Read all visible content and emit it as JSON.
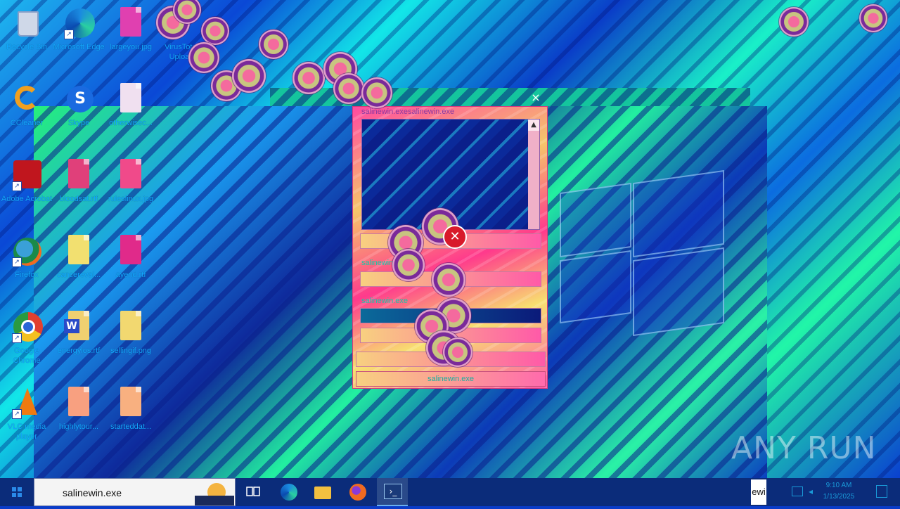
{
  "desktop": {
    "icons": [
      {
        "label": "Recycle Bin",
        "icon": "recycle-bin-icon"
      },
      {
        "label": "Microsoft Edge",
        "icon": "edge-icon"
      },
      {
        "label": "largeyou.jpg",
        "icon": "image-file-icon"
      },
      {
        "label": "VirusTotal Upload",
        "icon": "virustotal-icon"
      },
      {
        "label": "CCleaner",
        "icon": "ccleaner-icon"
      },
      {
        "label": "Skype",
        "icon": "skype-icon"
      },
      {
        "label": "otherwisec...",
        "icon": "image-file-icon"
      },
      {
        "label": "Adobe Acrobat",
        "icon": "acrobat-icon"
      },
      {
        "label": "bloodsat.rtf",
        "icon": "word-doc-icon"
      },
      {
        "label": "ruleslinux.jpg",
        "icon": "image-file-icon"
      },
      {
        "label": "Firefox",
        "icon": "firefox-icon"
      },
      {
        "label": "cancereval...",
        "icon": "image-file-icon"
      },
      {
        "label": "ayend.rtf",
        "icon": "word-doc-icon"
      },
      {
        "label": "Google Chrome",
        "icon": "chrome-icon"
      },
      {
        "label": "energylos.rtf",
        "icon": "word-doc-icon"
      },
      {
        "label": "sellingif.png",
        "icon": "image-file-icon"
      },
      {
        "label": "VLC media player",
        "icon": "vlc-icon"
      },
      {
        "label": "highlytour...",
        "icon": "image-file-icon"
      },
      {
        "label": "starteddat...",
        "icon": "image-file-icon"
      }
    ]
  },
  "app_window": {
    "title": "salinewin.exesalinewin.exe",
    "field_label_1": "salinewin",
    "field_label_2": "salinewin.exe",
    "footer": "salinewin.exe",
    "close_glyph": "×",
    "scroll_up_glyph": "▲",
    "error_glyph": "✕"
  },
  "watermark": "ANY RUN",
  "taskbar": {
    "search_value": "salinewin.exe",
    "tray_tag": "ewi",
    "clock_time": "9:10 AM",
    "clock_date": "1/13/2025"
  },
  "colors": {
    "taskbar": "#0b2c7a",
    "icon_label": "#13a8ff",
    "window_accent": "#ff4aa0"
  }
}
